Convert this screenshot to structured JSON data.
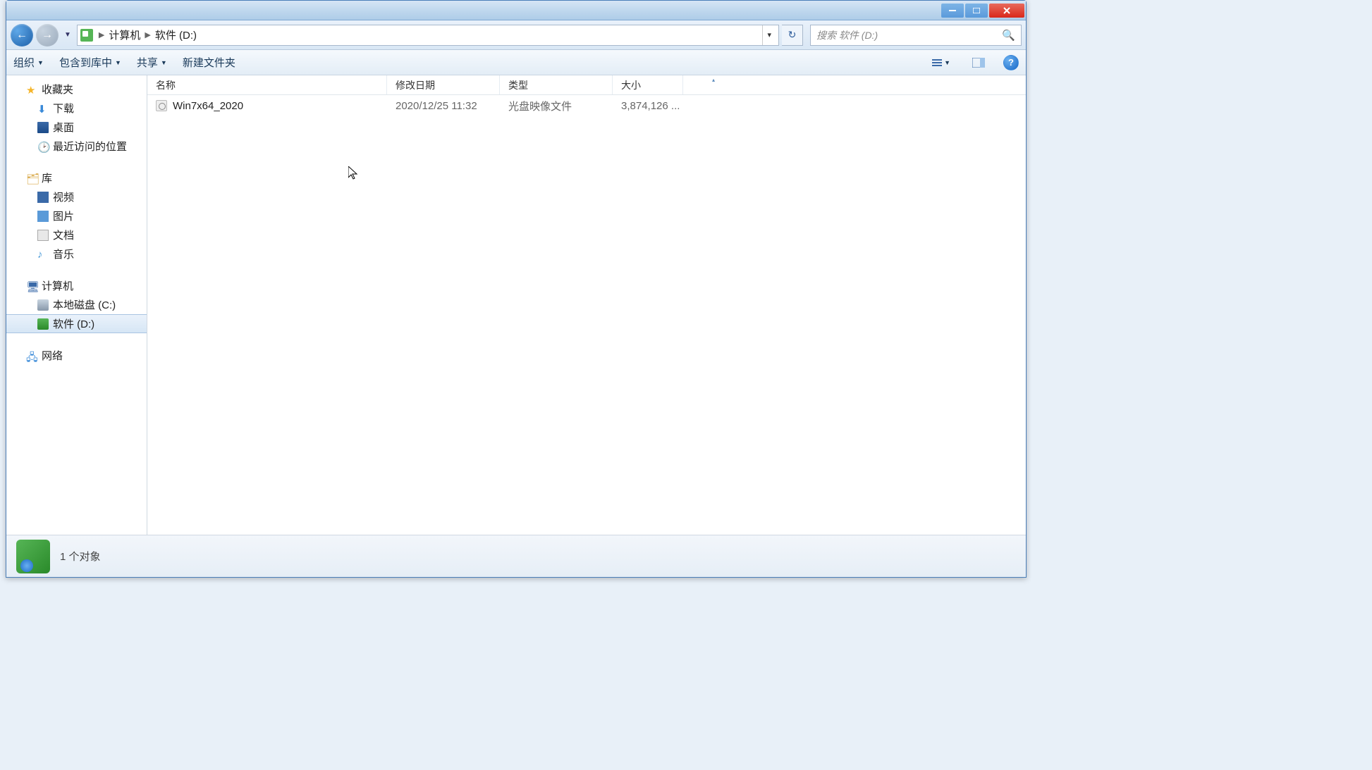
{
  "breadcrumbs": [
    "计算机",
    "软件 (D:)"
  ],
  "search": {
    "placeholder": "搜索 软件 (D:)"
  },
  "toolbar": {
    "organize": "组织",
    "include": "包含到库中",
    "share": "共享",
    "new_folder": "新建文件夹"
  },
  "columns": {
    "name": "名称",
    "date": "修改日期",
    "type": "类型",
    "size": "大小"
  },
  "tree": {
    "favorites": {
      "label": "收藏夹",
      "items": [
        "下载",
        "桌面",
        "最近访问的位置"
      ]
    },
    "libraries": {
      "label": "库",
      "items": [
        "视频",
        "图片",
        "文档",
        "音乐"
      ]
    },
    "computer": {
      "label": "计算机",
      "items": [
        "本地磁盘 (C:)",
        "软件 (D:)"
      ]
    },
    "network": {
      "label": "网络"
    }
  },
  "files": [
    {
      "name": "Win7x64_2020",
      "date": "2020/12/25 11:32",
      "type": "光盘映像文件",
      "size": "3,874,126 ..."
    }
  ],
  "status": {
    "text": "1 个对象"
  }
}
